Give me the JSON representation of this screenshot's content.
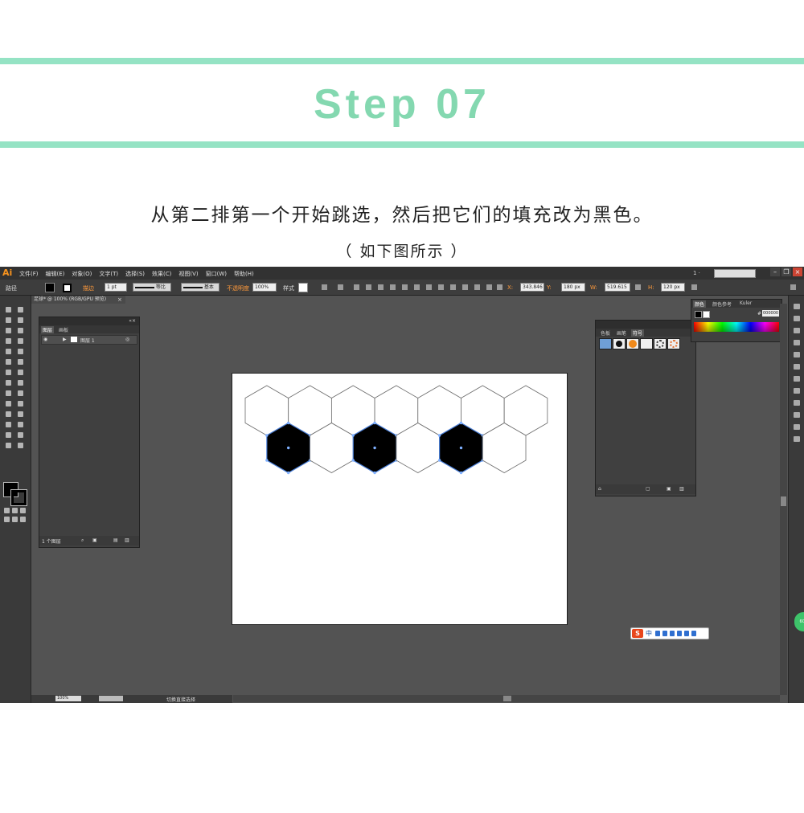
{
  "header": {
    "step_title": "Step 07",
    "instruction": "从第二排第一个开始跳选，然后把它们的填充改为黑色。",
    "sub_instruction": "（ 如下图所示 ）"
  },
  "colors": {
    "accent_bar": "#95e3c4",
    "accent_text": "#84d8b0",
    "app_background": "#535353",
    "selection_blue": "#4a7fd8",
    "fill_black": "#000000"
  },
  "app": {
    "logo": "Ai",
    "menus": [
      "文件(F)",
      "编辑(E)",
      "对象(O)",
      "文字(T)",
      "选择(S)",
      "效果(C)",
      "视图(V)",
      "窗口(W)",
      "帮助(H)"
    ],
    "workspace_selector": "1 ·",
    "control_bar": {
      "selection_label": "路径",
      "stroke_label": "描边",
      "stroke_weight": "1 pt",
      "profile_label": "等比",
      "brush_label": "基本",
      "opacity_label": "不透明度",
      "opacity_value": "100%",
      "style_label": "样式",
      "x_value": "343.846",
      "y_value": "180 px",
      "w_value": "519.615",
      "h_value": "120 px"
    },
    "document_tab": {
      "title": "足球* @ 100% (RGB/GPU 预览)",
      "close": "×"
    },
    "layers_panel": {
      "tabs": [
        "图层",
        "画板"
      ],
      "layer_name": "图层 1",
      "footer_count": "1 个图层"
    },
    "symbols_panel": {
      "tabs": [
        "色板",
        "画笔",
        "符号"
      ]
    },
    "color_panel": {
      "tabs": [
        "颜色",
        "颜色参考",
        "Kuler"
      ],
      "hex_prefix": "#",
      "hex_value": "000000"
    },
    "status_bar": {
      "zoom": "100%",
      "tool_name": "切换直接选择"
    },
    "ime_bar": {
      "logo": "S",
      "mode": "中"
    },
    "side_badge": "60s"
  },
  "hex_grid": {
    "row1_count": 7,
    "row2_count": 6,
    "selected_row2_indices": [
      0,
      2,
      4
    ],
    "fill_selected": "#000000",
    "fill_default": "#ffffff",
    "stroke": "#6a6a6a"
  }
}
